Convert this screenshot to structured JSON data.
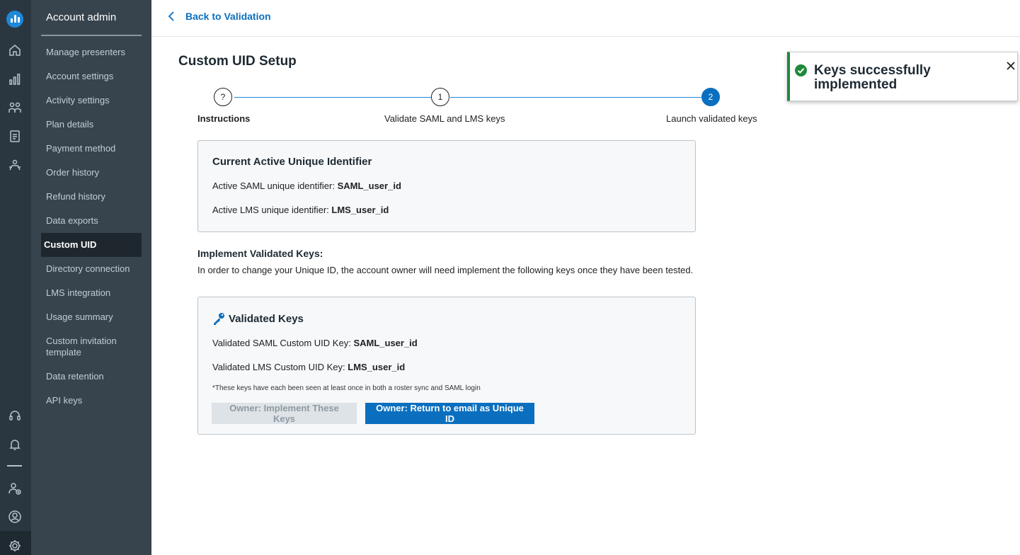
{
  "sidebar": {
    "title": "Account admin",
    "items": [
      {
        "label": "Manage presenters"
      },
      {
        "label": "Account settings"
      },
      {
        "label": "Activity settings"
      },
      {
        "label": "Plan details"
      },
      {
        "label": "Payment method"
      },
      {
        "label": "Order history"
      },
      {
        "label": "Refund history"
      },
      {
        "label": "Data exports"
      },
      {
        "label": "Custom UID",
        "active": true
      },
      {
        "label": "Directory connection"
      },
      {
        "label": "LMS integration"
      },
      {
        "label": "Usage summary"
      },
      {
        "label": "Custom invitation template"
      },
      {
        "label": "Data retention"
      },
      {
        "label": "API keys"
      }
    ]
  },
  "rail": {
    "icons": [
      "logo-icon",
      "home-icon",
      "bar-chart-icon",
      "users-icon",
      "clipboard-icon",
      "team-icon",
      "headset-icon",
      "bell-icon",
      "user-add-icon",
      "profile-icon",
      "gear-icon"
    ]
  },
  "header": {
    "back_label": "Back to Validation"
  },
  "page": {
    "title": "Custom UID Setup"
  },
  "stepper": {
    "steps": [
      {
        "marker": "?",
        "label": "Instructions"
      },
      {
        "marker": "1",
        "label": "Validate SAML and LMS keys"
      },
      {
        "marker": "2",
        "label": "Launch validated keys",
        "current": true
      }
    ]
  },
  "current_identifier": {
    "title": "Current Active Unique Identifier",
    "saml_label": "Active SAML unique identifier:",
    "saml_value": "SAML_user_id",
    "lms_label": "Active LMS unique identifier:",
    "lms_value": "LMS_user_id"
  },
  "implement": {
    "title": "Implement Validated Keys:",
    "description": "In order to change your Unique ID, the account owner will need implement the following keys once they have been tested."
  },
  "validated_keys": {
    "title": "Validated Keys",
    "saml_label": "Validated SAML Custom UID Key:",
    "saml_value": "SAML_user_id",
    "lms_label": "Validated LMS Custom UID Key:",
    "lms_value": "LMS_user_id",
    "note": "*These keys have each been seen at least once in both a roster sync and SAML login",
    "implement_button": "Owner: Implement These Keys",
    "return_button": "Owner: Return to email as Unique ID"
  },
  "toast": {
    "message": "Keys successfully implemented"
  },
  "colors": {
    "accent": "#0b6fbf",
    "success": "#1e8a3a",
    "sidebar_bg": "#37444e",
    "rail_bg": "#2b3740"
  }
}
